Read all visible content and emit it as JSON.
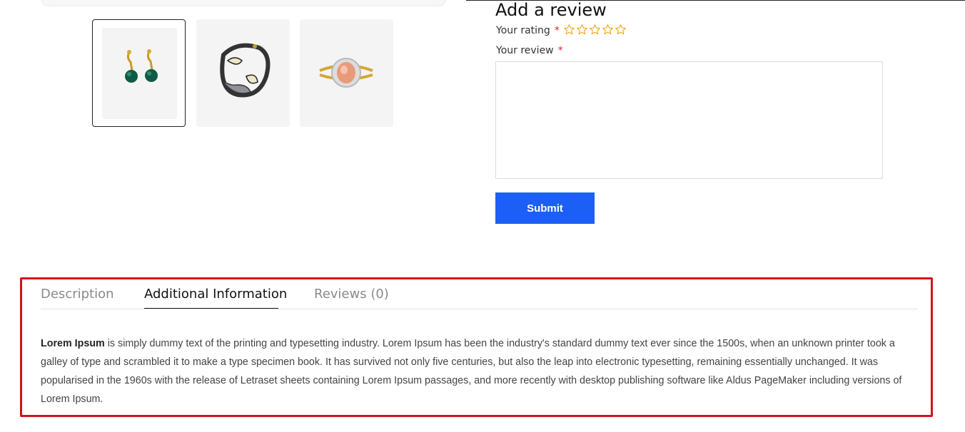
{
  "gallery": {
    "thumbnails": [
      {
        "name": "earrings-thumbnail",
        "selected": true
      },
      {
        "name": "bracelet-thumbnail",
        "selected": false
      },
      {
        "name": "ring-thumbnail",
        "selected": false
      }
    ]
  },
  "review_form": {
    "title": "Add a review",
    "rating_label": "Your rating",
    "review_label": "Your review",
    "required_mark": "*",
    "star_count": 5,
    "star_color": "#f0a71d",
    "review_value": "",
    "submit_label": "Submit",
    "submit_color": "#1b5ff7"
  },
  "tabs": {
    "items": [
      {
        "label": "Description",
        "active": false
      },
      {
        "label": "Additional Information",
        "active": true
      },
      {
        "label": "Reviews (0)",
        "active": false
      }
    ]
  },
  "content": {
    "bold_lead": "Lorem Ipsum",
    "body": " is simply dummy text of the printing and typesetting industry. Lorem Ipsum has been the industry's standard dummy text ever since the 1500s, when an unknown printer took a galley of type and scrambled it to make a type specimen book. It has survived not only five centuries, but also the leap into electronic typesetting, remaining essentially unchanged. It was popularised in the 1960s with the release of Letraset sheets containing Lorem Ipsum passages, and more recently with desktop publishing software like Aldus PageMaker including versions of Lorem Ipsum."
  },
  "highlight_color": "#d3131a"
}
